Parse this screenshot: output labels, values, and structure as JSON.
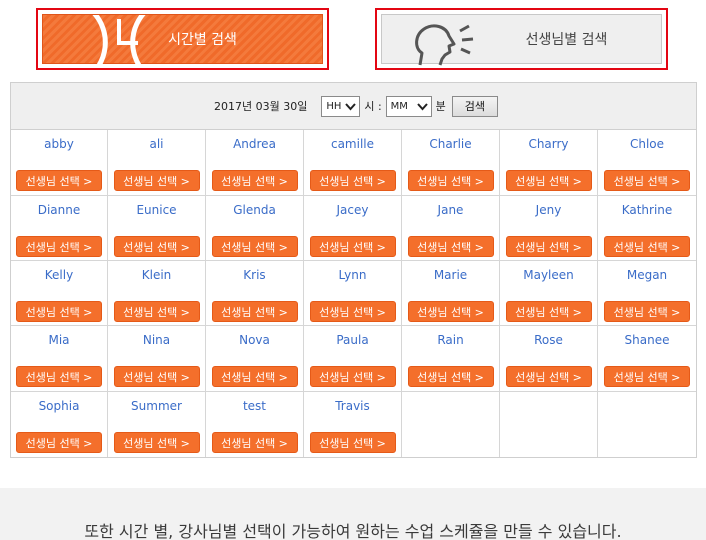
{
  "tabs": {
    "time_search": "시간별 검색",
    "teacher_search": "선생님별 검색"
  },
  "search": {
    "date": "2017년 03월 30일",
    "hour_value": "HH",
    "hour_unit": "시 :",
    "minute_value": "MM",
    "minute_unit": "분",
    "button": "검색"
  },
  "select_label": "선생님 선택 >",
  "teachers": [
    "abby",
    "ali",
    "Andrea",
    "camille",
    "Charlie",
    "Charry",
    "Chloe",
    "Dianne",
    "Eunice",
    "Glenda",
    "Jacey",
    "Jane",
    "Jeny",
    "Kathrine",
    "Kelly",
    "Klein",
    "Kris",
    "Lynn",
    "Marie",
    "Mayleen",
    "Megan",
    "Mia",
    "Nina",
    "Nova",
    "Paula",
    "Rain",
    "Rose",
    "Shanee",
    "Sophia",
    "Summer",
    "test",
    "Travis"
  ],
  "footer": "또한 시간 별, 강사님별 선택이 가능하여 원하는 수업 스케쥴을 만들 수 있습니다.",
  "colors": {
    "accent": "#f46f2b",
    "highlight_border": "#e30613",
    "name_link": "#3a6cc8"
  }
}
